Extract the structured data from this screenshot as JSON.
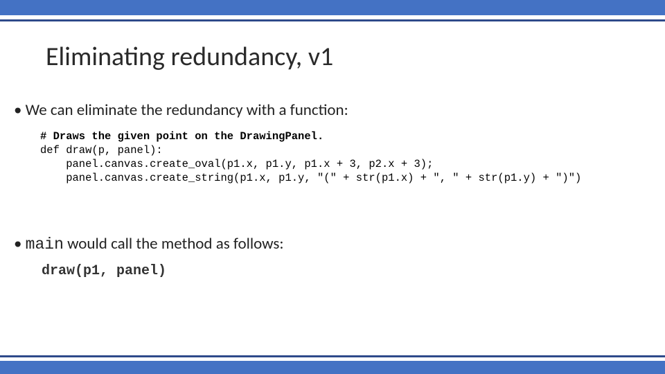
{
  "title": "Eliminating redundancy, v1",
  "bullet1": "We can eliminate the redundancy with a function:",
  "code": {
    "comment": "# Draws the given point on the DrawingPanel.",
    "def": "def draw(p, panel):",
    "l1": "    panel.canvas.create_oval(p1.x, p1.y, p1.x + 3, p2.x + 3);",
    "l2": "    panel.canvas.create_string(p1.x, p1.y, \"(\" + str(p1.x) + \", \" + str(p1.y) + \")\")"
  },
  "bullet2_pre": "",
  "bullet2_mono": "main",
  "bullet2_post": " would call the method as follows:",
  "call": "draw(p1, panel)"
}
